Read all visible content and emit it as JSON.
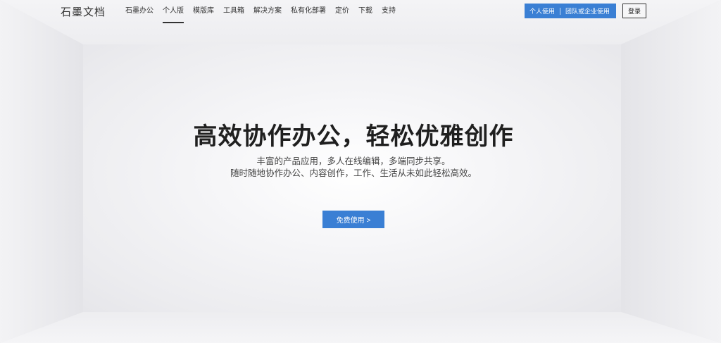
{
  "header": {
    "logo": "石墨文档",
    "nav": [
      {
        "label": "石墨办公",
        "active": false
      },
      {
        "label": "个人版",
        "active": true
      },
      {
        "label": "模版库",
        "active": false
      },
      {
        "label": "工具箱",
        "active": false
      },
      {
        "label": "解决方案",
        "active": false
      },
      {
        "label": "私有化部署",
        "active": false
      },
      {
        "label": "定价",
        "active": false
      },
      {
        "label": "下载",
        "active": false
      },
      {
        "label": "支持",
        "active": false
      }
    ],
    "cta_personal": "个人使用",
    "cta_team": "团队或企业使用",
    "login": "登录"
  },
  "hero": {
    "title": "高效协作办公，轻松优雅创作",
    "subtitle_line1": "丰富的产品应用，多人在线编辑，多端同步共享。",
    "subtitle_line2": "随时随地协作办公、内容创作，工作、生活从未如此轻松高效。",
    "button": "免费使用 >"
  },
  "colors": {
    "accent": "#3a7fd4",
    "text": "#222222"
  }
}
